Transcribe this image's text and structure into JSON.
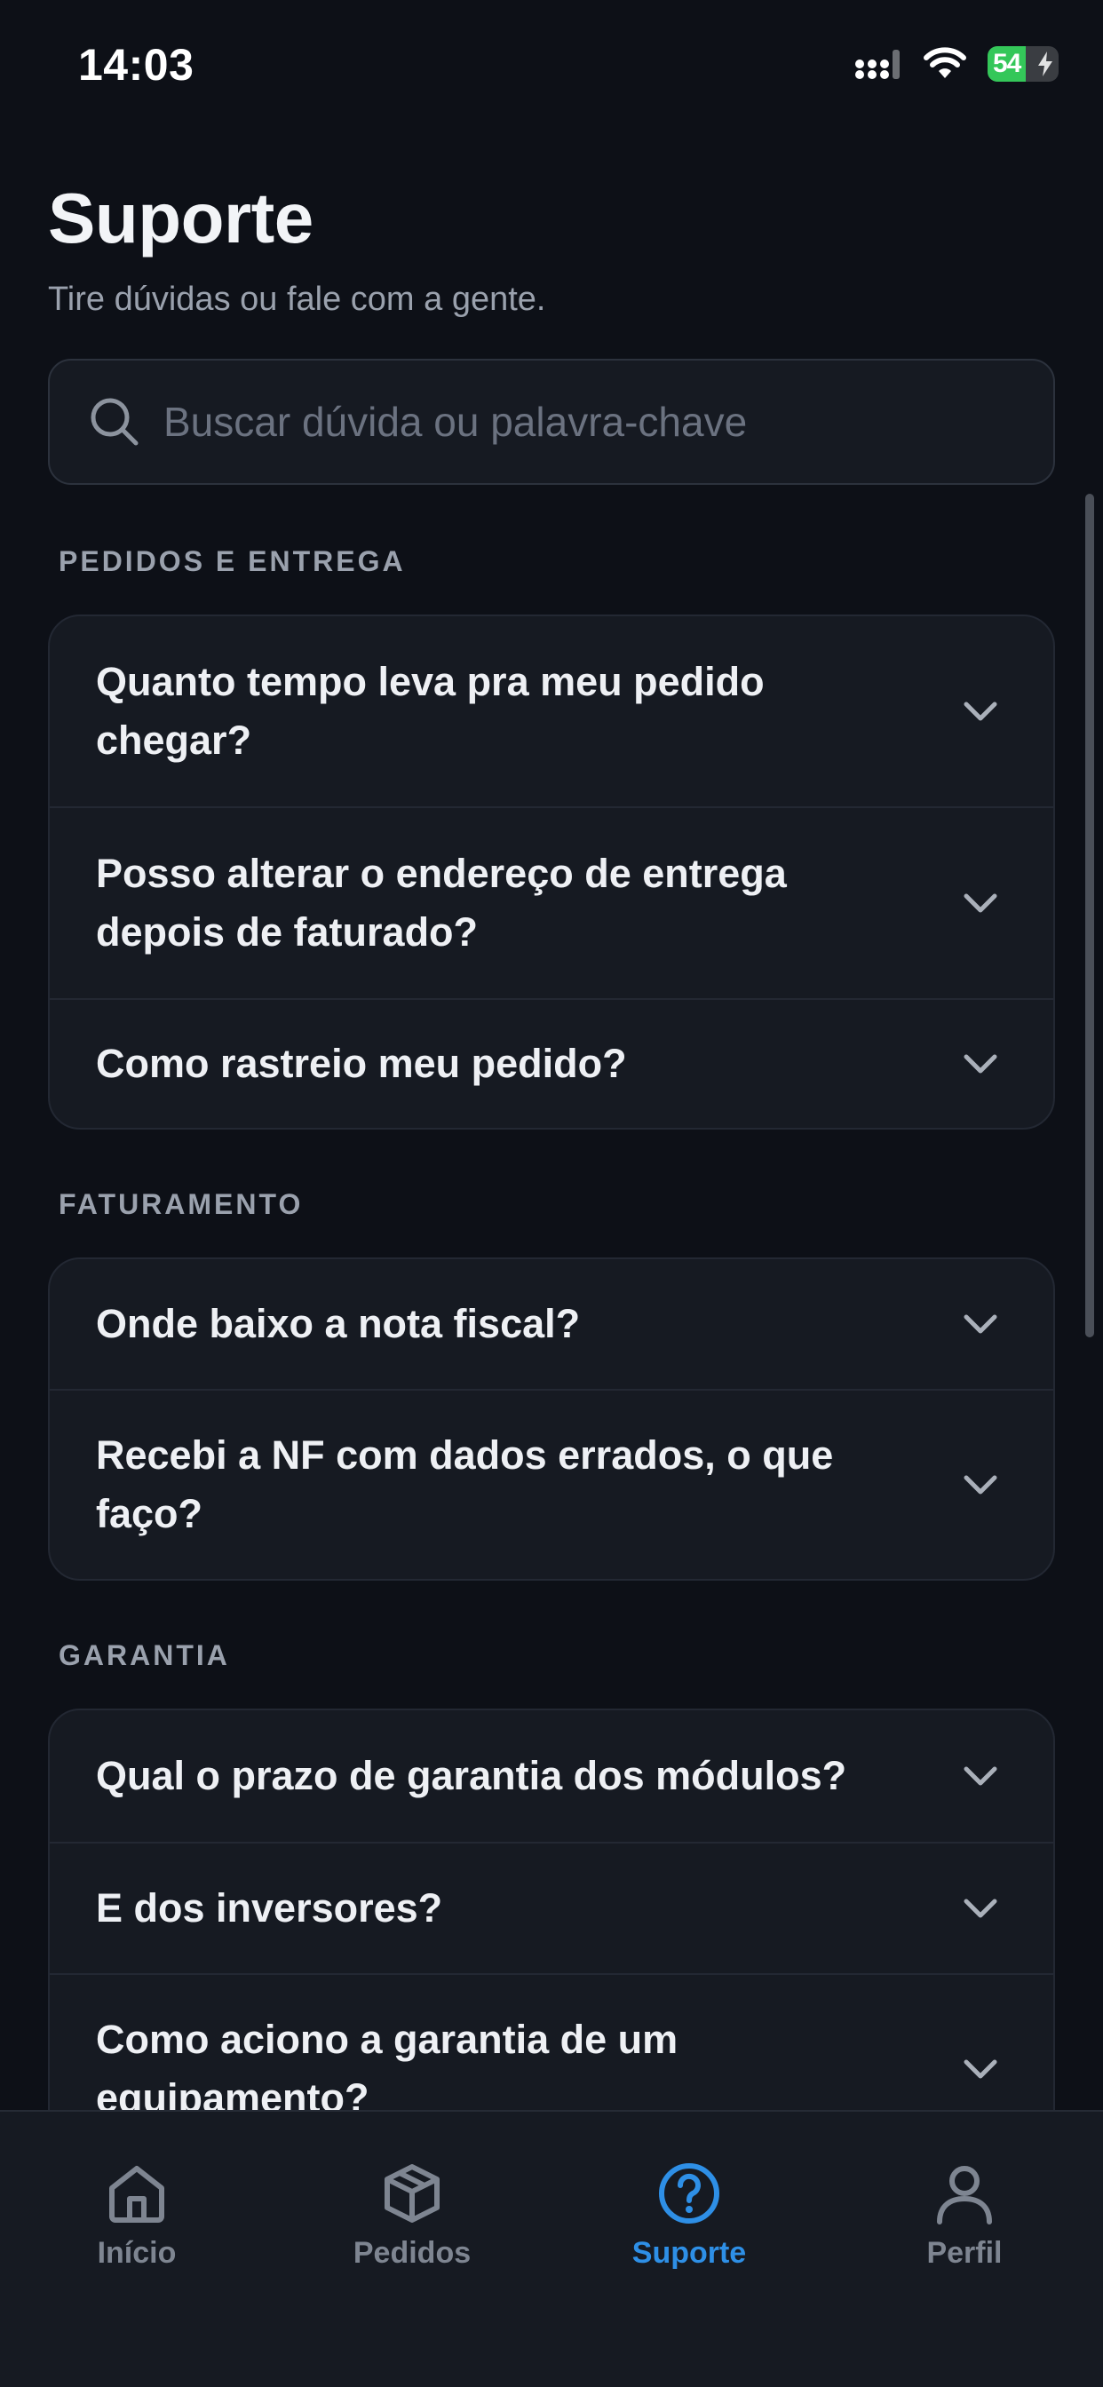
{
  "status_bar": {
    "time": "14:03",
    "battery": "54"
  },
  "header": {
    "title": "Suporte",
    "subtitle": "Tire dúvidas ou fale com a gente."
  },
  "search": {
    "placeholder": "Buscar dúvida ou palavra-chave",
    "value": ""
  },
  "sections": [
    {
      "label": "PEDIDOS E ENTREGA",
      "items": [
        {
          "line1": "Quanto tempo leva pra meu pedido",
          "line2": "chegar?"
        },
        {
          "line1": "Posso alterar o endereço de entrega",
          "line2": "depois de faturado?"
        },
        {
          "line1": "Como rastreio meu pedido?",
          "line2": ""
        }
      ]
    },
    {
      "label": "FATURAMENTO",
      "items": [
        {
          "line1": "Onde baixo a nota fiscal?",
          "line2": ""
        },
        {
          "line1": "Recebi a NF com dados errados, o que",
          "line2": "faço?"
        }
      ]
    },
    {
      "label": "GARANTIA",
      "items": [
        {
          "line1": "Qual o prazo de garantia dos módulos?",
          "line2": ""
        },
        {
          "line1": "E dos inversores?",
          "line2": ""
        },
        {
          "line1": "Como aciono a garantia de um",
          "line2": "equipamento?"
        }
      ]
    }
  ],
  "tabs": [
    {
      "label": "Início",
      "icon": "home-icon"
    },
    {
      "label": "Pedidos",
      "icon": "box-icon"
    },
    {
      "label": "Suporte",
      "icon": "help-icon",
      "active": true
    },
    {
      "label": "Perfil",
      "icon": "user-icon"
    }
  ],
  "colors": {
    "background": "#0d1017",
    "card": "#161a22",
    "accent": "#2e8fe6",
    "battery": "#34c759"
  }
}
